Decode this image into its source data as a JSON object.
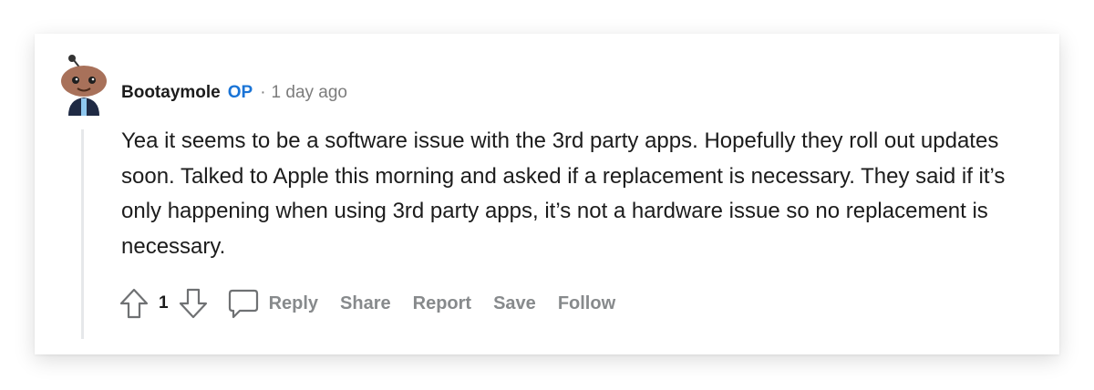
{
  "comment": {
    "author": "Bootaymole",
    "op_badge": "OP",
    "separator": "·",
    "time": "1 day ago",
    "body": "Yea it seems to be a software issue with the 3rd party apps. Hopefully they roll out updates soon. Talked to Apple this morning and asked if a replacement is necessary. They said if it’s only happening when using 3rd party apps, it’s not a hardware issue so no replacement is necessary.",
    "vote_count": "1",
    "actions": {
      "reply": "Reply",
      "share": "Share",
      "report": "Report",
      "save": "Save",
      "follow": "Follow"
    },
    "icons": {
      "upvote": "upvote-arrow-icon",
      "downvote": "downvote-arrow-icon",
      "comment": "speech-bubble-icon"
    }
  },
  "colors": {
    "op_badge": "#1a74d6",
    "muted_text": "#7c7c7c",
    "action_text": "#878a8c",
    "body_text": "#1c1c1c",
    "thread_line": "#e6e8ea"
  }
}
